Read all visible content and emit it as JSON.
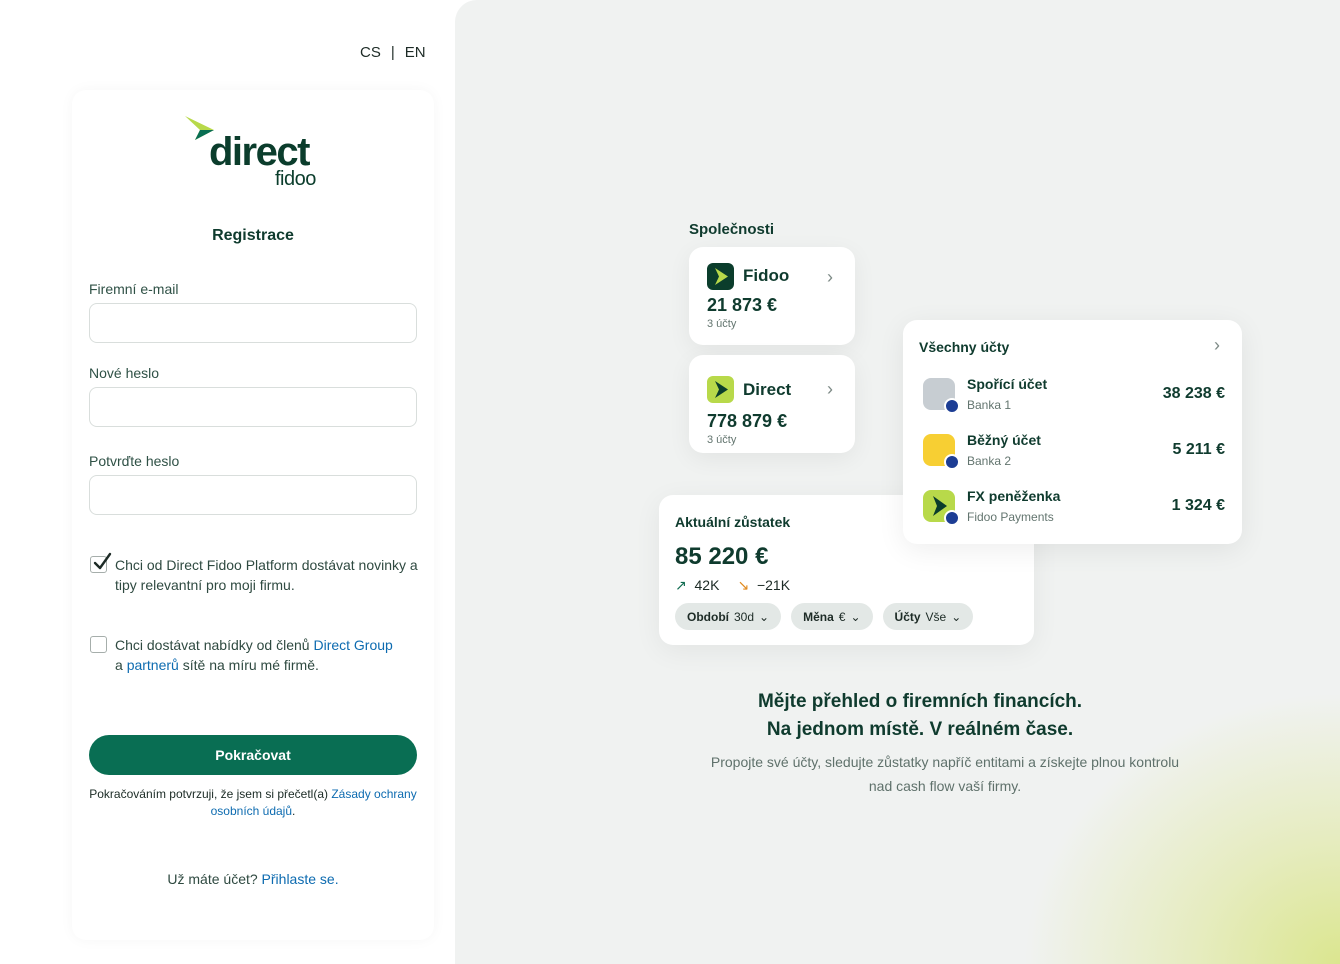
{
  "lang": {
    "cs": "CS",
    "sep": "|",
    "en": "EN"
  },
  "logo": {
    "word": "direct",
    "sub": "fidoo"
  },
  "form": {
    "title": "Registrace",
    "email_label": "Firemní e-mail",
    "email_value": "",
    "password_label": "Nové heslo",
    "password_value": "",
    "confirm_label": "Potvrďte heslo",
    "confirm_value": "",
    "news_checkbox_text": "Chci od Direct Fidoo Platform dostávat novinky a tipy relevantní pro moji firmu.",
    "news_checked": true,
    "offers_text_1": "Chci dostávat nabídky od členů ",
    "offers_link_1": "Direct Group",
    "offers_text_2": " a ",
    "offers_link_2": "partnerů",
    "offers_text_3": " sítě na míru mé firmě.",
    "offers_checked": false,
    "submit_label": "Pokračovat",
    "legal_text": "Pokračováním potvrzuji, že jsem si přečetl(a) ",
    "legal_link": "Zásady ochrany osobních údajů",
    "legal_end": ".",
    "login_text": "Už máte účet? ",
    "login_link": "Přihlaste se."
  },
  "companies": {
    "heading": "Společnosti",
    "items": [
      {
        "name": "Fidoo",
        "amount": "21 873 €",
        "sub": "3 účty",
        "icon": "fidoo-arrow-icon",
        "icon_bg": "#0b3d2c"
      },
      {
        "name": "Direct",
        "amount": "778 879 €",
        "sub": "3 účty",
        "icon": "direct-arrow-icon",
        "icon_bg": "#b8d94a"
      }
    ]
  },
  "balance": {
    "title": "Aktuální zůstatek",
    "amount": "85 220 €",
    "up": "42K",
    "down": "−21K",
    "filters": [
      {
        "label": "Období",
        "value": "30d"
      },
      {
        "label": "Měna",
        "value": "€"
      },
      {
        "label": "Účty",
        "value": "Vše"
      }
    ]
  },
  "accounts": {
    "title": "Všechny účty",
    "items": [
      {
        "name": "Spořící účet",
        "bank": "Banka 1",
        "amount": "38 238 €",
        "color": "#c7cdd2"
      },
      {
        "name": "Běžný účet",
        "bank": "Banka 2",
        "amount": "5 211 €",
        "color": "#f7cf33"
      },
      {
        "name": "FX peněženka",
        "bank": "Fidoo Payments",
        "amount": "1 324 €",
        "color": "#b8d94a"
      }
    ]
  },
  "promo": {
    "headline_1": "Mějte přehled o firemních financích.",
    "headline_2": "Na jednom místě. V reálném čase.",
    "desc": "Propojte své účty, sledujte zůstatky napříč entitami a získejte plnou kontrolu nad cash flow vaší firmy."
  },
  "colors": {
    "brand": "#096e53",
    "lime": "#b8d94a",
    "link": "#0d6bb0"
  }
}
